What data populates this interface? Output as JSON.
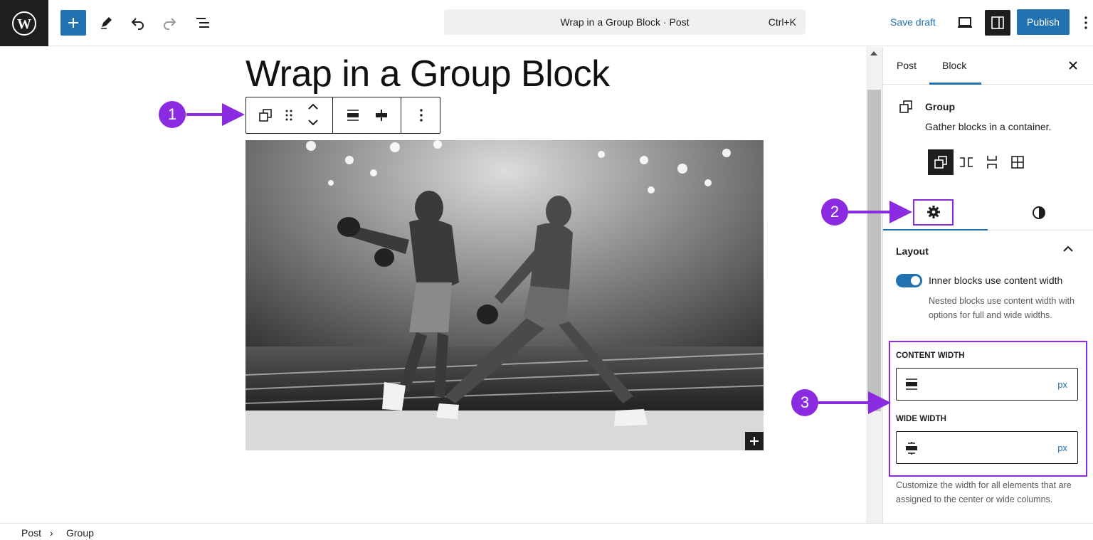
{
  "topbar": {
    "logo_icon": "wordpress-logo",
    "add_block_icon": "plus-icon",
    "tools_icon": "pencil-icon",
    "undo_icon": "undo-icon",
    "redo_icon": "redo-icon",
    "list_view_icon": "list-view-icon",
    "document_title": "Wrap in a Group Block · Post",
    "shortcut": "Ctrl+K",
    "save_draft": "Save draft",
    "view_icon": "laptop-icon",
    "settings_icon": "sidebar-icon",
    "publish": "Publish",
    "options_icon": "vertical-ellipsis-icon"
  },
  "canvas": {
    "post_title": "Wrap in a Group Block",
    "block_toolbar": {
      "icons": [
        "group-icon",
        "drag-handle-icon",
        "move-up-icon",
        "move-down-icon",
        "justify-icon",
        "align-icon",
        "more-options-icon"
      ]
    },
    "image_add_icon": "plus-icon"
  },
  "sidebar": {
    "tabs": [
      "Post",
      "Block"
    ],
    "active_tab": "Block",
    "close_icon": "close-icon",
    "block": {
      "name": "Group",
      "description": "Gather blocks in a container.",
      "icon": "group-icon",
      "variations": [
        "group",
        "row",
        "stack",
        "grid"
      ]
    },
    "panel_tabs": {
      "settings_icon": "gear-icon",
      "styles_icon": "contrast-icon"
    },
    "layout": {
      "title": "Layout",
      "toggle_label": "Inner blocks use content width",
      "toggle_on": true,
      "toggle_help": "Nested blocks use content width with options for full and wide widths.",
      "content_width_label": "CONTENT WIDTH",
      "content_width_unit": "px",
      "wide_width_label": "WIDE WIDTH",
      "wide_width_unit": "px",
      "help": "Customize the width for all elements that are assigned to the center or wide columns."
    }
  },
  "breadcrumb": {
    "items": [
      "Post",
      "Group"
    ],
    "separator": "›"
  },
  "annotations": {
    "callouts": [
      "1",
      "2",
      "3"
    ],
    "color": "#8a2be2"
  },
  "colors": {
    "accent": "#2271b1",
    "dark": "#1e1e1e"
  }
}
